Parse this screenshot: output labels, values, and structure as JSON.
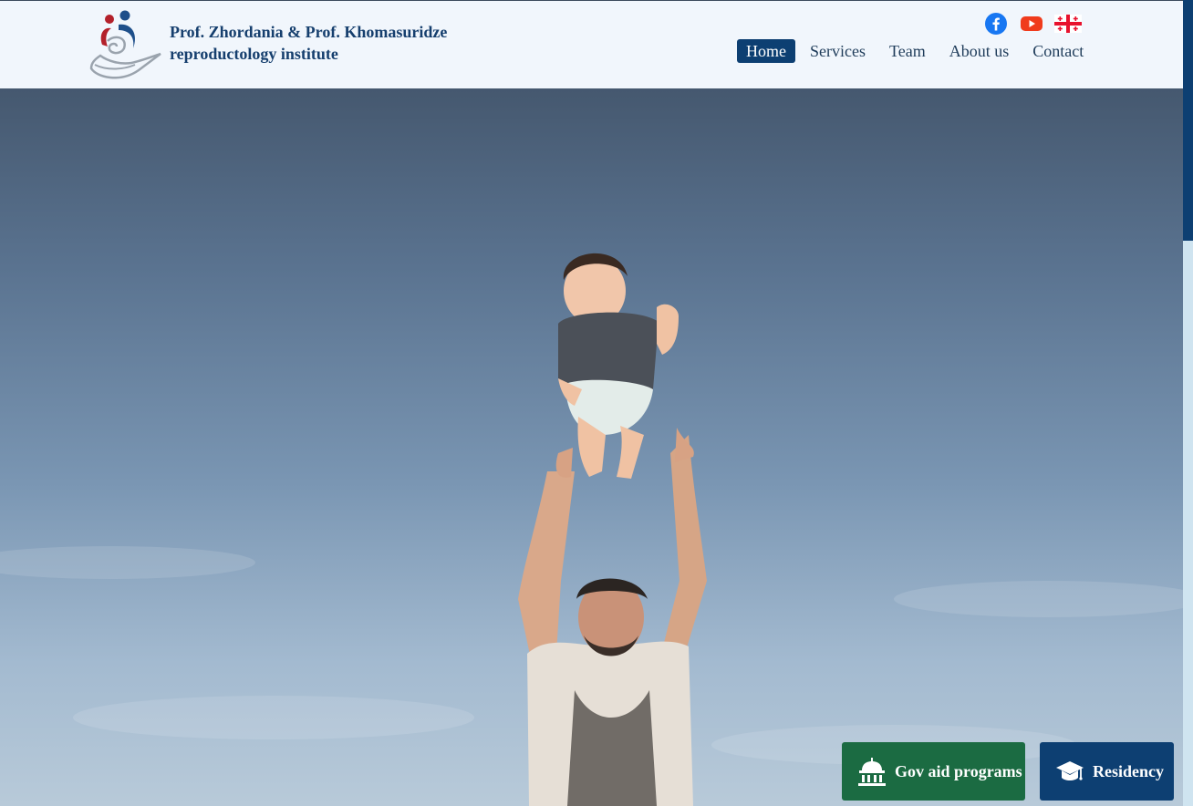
{
  "header": {
    "brand_line1": "Prof. Zhordania & Prof. Khomasuridze",
    "brand_line2": "reproductology institute",
    "social": [
      {
        "icon": "facebook-icon",
        "color": "#1877f2"
      },
      {
        "icon": "youtube-icon",
        "color": "#f03b1c"
      },
      {
        "icon": "georgia-flag-icon",
        "color": "#e8112d"
      }
    ]
  },
  "nav": {
    "items": [
      {
        "label": "Home",
        "active": true
      },
      {
        "label": "Services",
        "active": false
      },
      {
        "label": "Team",
        "active": false
      },
      {
        "label": "About us",
        "active": false
      },
      {
        "label": "Contact",
        "active": false
      }
    ]
  },
  "cta": {
    "gov_label": "Gov aid programs",
    "residency_label": "Residency"
  },
  "colors": {
    "primary": "#0d3f72",
    "green": "#1b6b42",
    "header_bg": "#f1f6fc"
  }
}
